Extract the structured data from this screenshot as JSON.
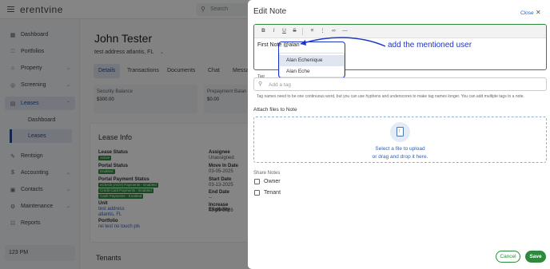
{
  "app": {
    "logo": "erentvine",
    "search_placeholder": "Search",
    "sidebar": {
      "items": [
        {
          "label": "Dashboard",
          "icon": "grid-icon"
        },
        {
          "label": "Portfolios",
          "icon": "folder-icon"
        },
        {
          "label": "Property",
          "icon": "home-icon"
        },
        {
          "label": "Screening",
          "icon": "screening-icon"
        },
        {
          "label": "Leases",
          "icon": "lease-icon"
        },
        {
          "label": "Rentsign",
          "icon": "rentsign-icon"
        },
        {
          "label": "Accounting",
          "icon": "dollar-icon"
        },
        {
          "label": "Contacts",
          "icon": "contacts-icon"
        },
        {
          "label": "Maintenance",
          "icon": "wrench-icon"
        },
        {
          "label": "Reports",
          "icon": "reports-icon"
        }
      ],
      "sub_items": [
        "Dashboard",
        "Leases"
      ],
      "clock": "123 PM"
    },
    "tenant": {
      "name": "John Tester",
      "address": "test address atlantis, FL"
    },
    "tabs": [
      "Details",
      "Transactions",
      "Documents",
      "Chat",
      "Messa"
    ],
    "balances": [
      {
        "label": "Security Balance",
        "value": "$300.00"
      },
      {
        "label": "Prepayment Balan",
        "value": "$0.00"
      }
    ],
    "lease_info": {
      "title": "Lease Info",
      "lease_status_label": "Lease Status",
      "lease_status_chip": "Active",
      "portal_status_label": "Portal Status",
      "portal_status_chip": "Enabled",
      "portal_payment_label": "Portal Payment Status",
      "payment_chips": [
        "eCheck (ACH) Payments - Enabled",
        "Credit Card Payments - Enabled",
        "Cash Payments - Enabled"
      ],
      "unit_label": "Unit",
      "unit_value": "test address",
      "unit_value2": "atlantis, FL",
      "portfolio_label": "Portfolio",
      "portfolio_value": "rei test no touch pls",
      "assignee_label": "Assignee",
      "assignee_value": "Unassigned",
      "move_in_label": "Move In Date",
      "move_in_value": "03-05-2025",
      "start_label": "Start Date",
      "start_value": "03-13-2025",
      "end_label": "End Date",
      "end_value": "--",
      "eligibility_label": "Increase Eligibility",
      "eligibility_value": "03-05-2026"
    },
    "tenants_heading": "Tenants"
  },
  "drawer": {
    "title": "Edit Note",
    "close_label": "Close",
    "toolbar": [
      "B",
      "I",
      "U",
      "S",
      "ordered-list",
      "bullet-list",
      "link",
      "hr"
    ],
    "note_text": "First Note ",
    "mention_text": "@alan",
    "suggestions": [
      "Alan Echenique",
      "Alan Eche"
    ],
    "annotation": "add the mentioned user",
    "annotation_color": "#1c35c7",
    "tag_label": "Tag",
    "tag_placeholder": "Add a tag",
    "tag_help": "Tag names need to be one continuous word, but you can use hyphens and underscores to make tag names longer. You can add multiple tags to a note.",
    "attach_label": "Attach files to Note",
    "upload_line1": "Select a file to upload",
    "upload_line2": "or drag and drop it here.",
    "share_label": "Share Notes",
    "share_options": [
      "Owner",
      "Tenant"
    ],
    "cancel_label": "Cancel",
    "save_label": "Save",
    "accent_color": "#2d8a3c"
  }
}
